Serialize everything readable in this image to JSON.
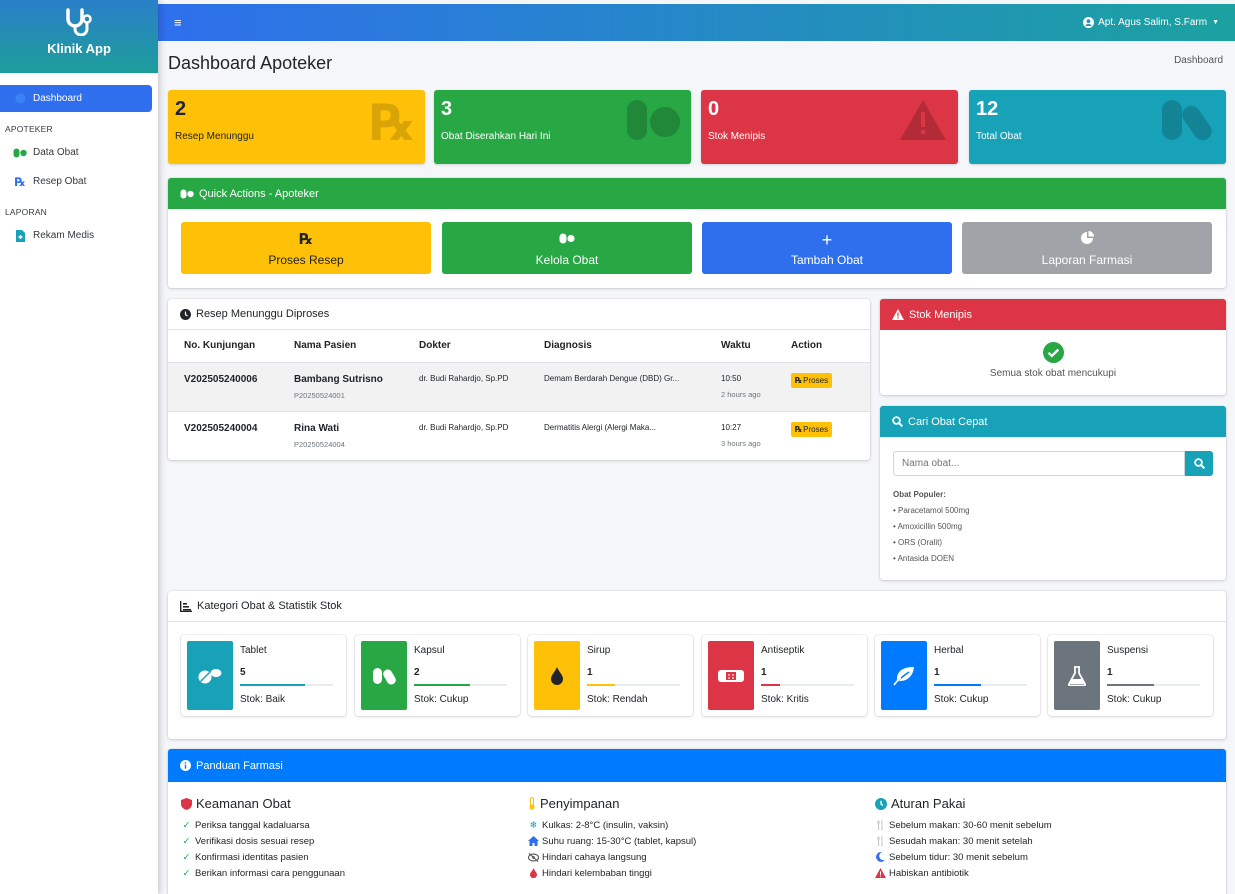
{
  "app": {
    "name": "Klinik App"
  },
  "sidebar": {
    "dashboard": "Dashboard",
    "sec_apoteker": "APOTEKER",
    "data_obat": "Data Obat",
    "resep_obat": "Resep Obat",
    "sec_laporan": "LAPORAN",
    "rekam_medis": "Rekam Medis"
  },
  "topbar": {
    "user": "Apt. Agus Salim, S.Farm"
  },
  "page": {
    "title": "Dashboard Apoteker",
    "breadcrumb": "Dashboard"
  },
  "stats": [
    {
      "value": "2",
      "label": "Resep Menunggu",
      "color": "#ffc107"
    },
    {
      "value": "3",
      "label": "Obat Diserahkan Hari Ini",
      "color": "#28a745"
    },
    {
      "value": "0",
      "label": "Stok Menipis",
      "color": "#dc3545"
    },
    {
      "value": "12",
      "label": "Total Obat",
      "color": "#17a2b8"
    }
  ],
  "quick": {
    "title": "Quick Actions - Apoteker",
    "proses": "Proses Resep",
    "kelola": "Kelola Obat",
    "tambah": "Tambah Obat",
    "laporan": "Laporan Farmasi"
  },
  "resep": {
    "title": "Resep Menunggu Diproses",
    "cols": [
      "No. Kunjungan",
      "Nama Pasien",
      "Dokter",
      "Diagnosis",
      "Waktu",
      "Action"
    ],
    "rows": [
      {
        "visit": "V202505240006",
        "name": "Bambang Sutrisno",
        "pid": "P20250524001",
        "doctor": "dr. Budi Rahardjo, Sp.PD",
        "diag": "Demam Berdarah Dengue (DBD) Gr...",
        "time": "10:50",
        "ago": "2 hours ago",
        "action": "Proses"
      },
      {
        "visit": "V202505240004",
        "name": "Rina Wati",
        "pid": "P20250524004",
        "doctor": "dr. Budi Rahardjo, Sp.PD",
        "diag": "Dermatitis Alergi (Alergi Maka...",
        "time": "10:27",
        "ago": "3 hours ago",
        "action": "Proses"
      }
    ]
  },
  "stok": {
    "title": "Stok Menipis",
    "message": "Semua stok obat mencukupi"
  },
  "cari": {
    "title": "Cari Obat Cepat",
    "placeholder": "Nama obat...",
    "popular_title": "Obat Populer:",
    "popular": [
      "• Paracetamol 500mg",
      "• Amoxicillin 500mg",
      "• ORS (Oralit)",
      "• Antasida DOEN"
    ]
  },
  "kategori": {
    "title": "Kategori Obat & Statistik Stok",
    "items": [
      {
        "name": "Tablet",
        "count": "5",
        "status": "Stok: Baik",
        "color": "#17a2b8",
        "bar_color": "#17a2b8",
        "level": 0.7
      },
      {
        "name": "Kapsul",
        "count": "2",
        "status": "Stok: Cukup",
        "color": "#28a745",
        "bar_color": "#28a745",
        "level": 0.6
      },
      {
        "name": "Sirup",
        "count": "1",
        "status": "Stok: Rendah",
        "color": "#ffc107",
        "bar_color": "#ffc107",
        "level": 0.3
      },
      {
        "name": "Antiseptik",
        "count": "1",
        "status": "Stok: Kritis",
        "color": "#dc3545",
        "bar_color": "#dc3545",
        "level": 0.2
      },
      {
        "name": "Herbal",
        "count": "1",
        "status": "Stok: Cukup",
        "color": "#007bff",
        "bar_color": "#007bff",
        "level": 0.5
      },
      {
        "name": "Suspensi",
        "count": "1",
        "status": "Stok: Cukup",
        "color": "#6c757d",
        "bar_color": "#6c757d",
        "level": 0.5
      }
    ]
  },
  "panduan": {
    "title": "Panduan Farmasi",
    "keamanan": {
      "title": "Keamanan Obat",
      "items": [
        "Periksa tanggal kadaluarsa",
        "Verifikasi dosis sesuai resep",
        "Konfirmasi identitas pasien",
        "Berikan informasi cara penggunaan"
      ]
    },
    "penyimpanan": {
      "title": "Penyimpanan",
      "items": [
        "Kulkas: 2-8°C (insulin, vaksin)",
        "Suhu ruang: 15-30°C (tablet, kapsul)",
        "Hindari cahaya langsung",
        "Hindari kelembaban tinggi"
      ]
    },
    "aturan": {
      "title": "Aturan Pakai",
      "items": [
        "Sebelum makan: 30-60 menit sebelum",
        "Sesudah makan: 30 menit setelah",
        "Sebelum tidur: 30 menit sebelum",
        "Habiskan antibiotik"
      ]
    }
  }
}
